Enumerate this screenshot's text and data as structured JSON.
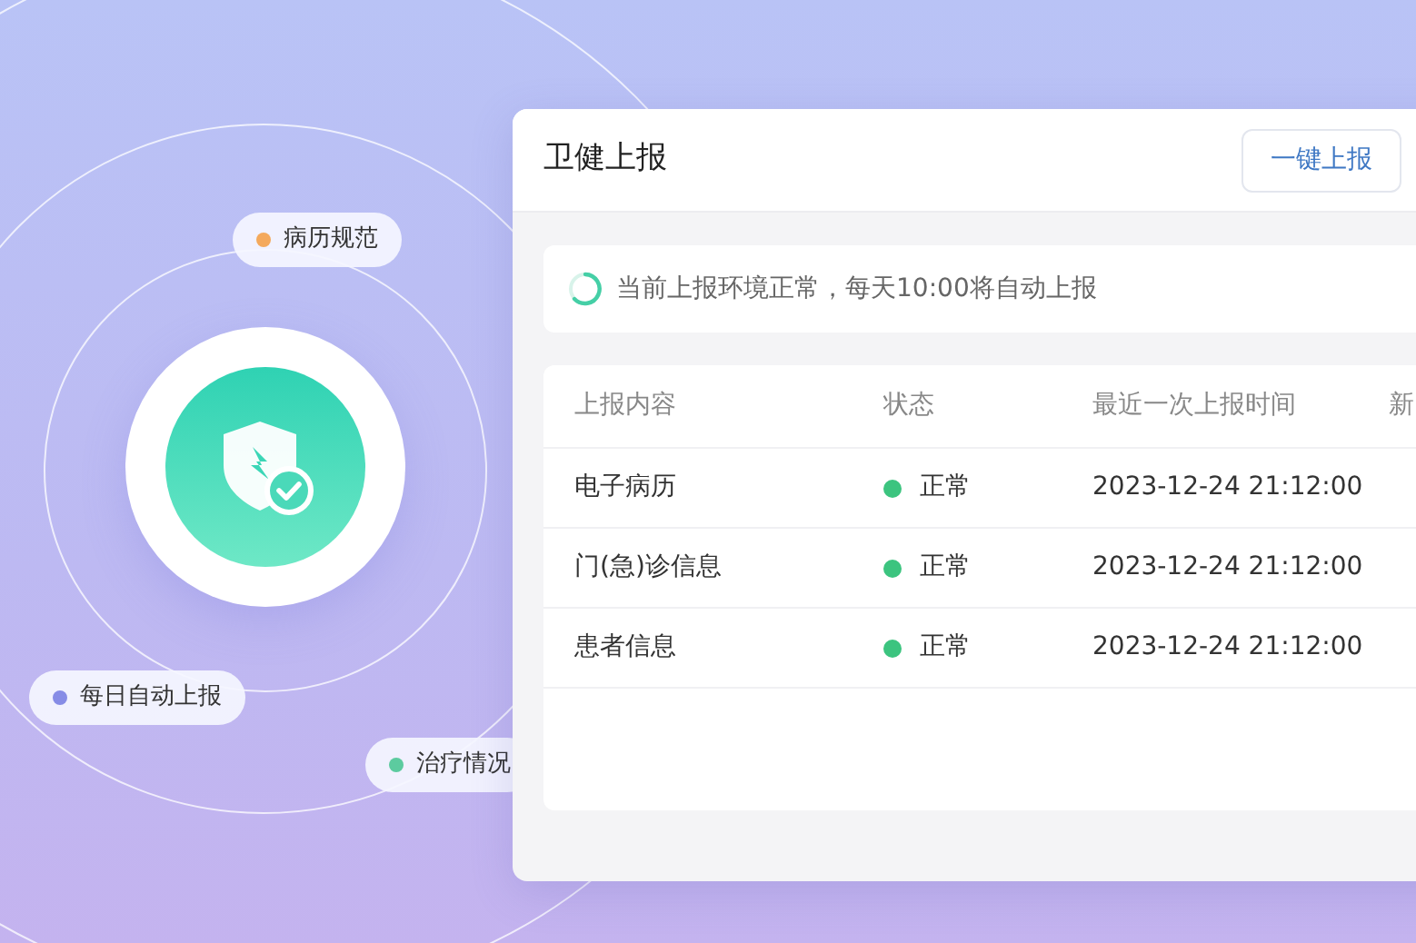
{
  "tags": [
    {
      "label": "病历规范",
      "color": "#f4a95c"
    },
    {
      "label": "每日自动上报",
      "color": "#868ce6"
    },
    {
      "label": "治疗情况",
      "color": "#5ccb9f"
    }
  ],
  "panel": {
    "title": "卫健上报",
    "button": "一键上报",
    "notice": "当前上报环境正常，每天10:00将自动上报"
  },
  "table": {
    "columns": [
      "上报内容",
      "状态",
      "最近一次上报时间",
      "新"
    ],
    "rows": [
      {
        "content": "电子病历",
        "status": "正常",
        "color": "#3cc47f",
        "time": "2023-12-24 21:12:00"
      },
      {
        "content": "门(急)诊信息",
        "status": "正常",
        "color": "#3cc47f",
        "time": "2023-12-24 21:12:00"
      },
      {
        "content": "患者信息",
        "status": "正常",
        "color": "#3cc47f",
        "time": "2023-12-24 21:12:00"
      }
    ]
  }
}
